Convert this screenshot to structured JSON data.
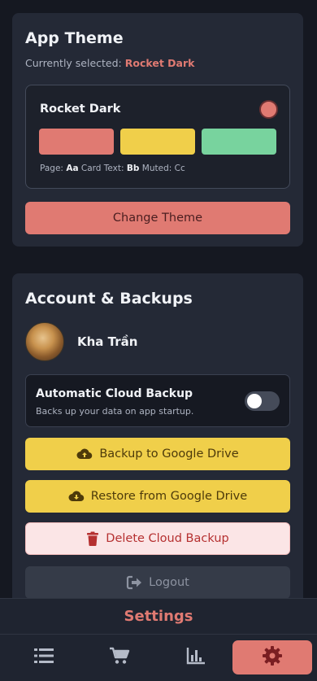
{
  "theme_card": {
    "title": "App Theme",
    "subtitle_prefix": "Currently selected:",
    "selected_theme": "Rocket Dark",
    "option": {
      "name": "Rocket Dark",
      "swatches": [
        "#e07a72",
        "#f0cf4a",
        "#78d39e"
      ],
      "dot_color": "#e07a72",
      "legend": {
        "page_label": "Page:",
        "page_sample": "Aa",
        "card_label": "Card Text:",
        "card_sample": "Bb",
        "muted_label": "Muted:",
        "muted_sample": "Cc"
      }
    },
    "change_button": "Change Theme"
  },
  "account_card": {
    "title": "Account & Backups",
    "user_name": "Kha Trần",
    "auto_backup": {
      "title": "Automatic Cloud Backup",
      "description": "Backs up your data on app startup.",
      "enabled": false
    },
    "buttons": {
      "backup": "Backup to Google Drive",
      "restore": "Restore from Google Drive",
      "delete": "Delete Cloud Backup",
      "logout": "Logout"
    }
  },
  "header": {
    "title": "Settings"
  },
  "tabs": [
    {
      "icon": "list-icon",
      "active": false
    },
    {
      "icon": "cart-icon",
      "active": false
    },
    {
      "icon": "chart-icon",
      "active": false
    },
    {
      "icon": "gear-icon",
      "active": true
    }
  ],
  "colors": {
    "accent": "#e07a72",
    "yellow": "#f0cf4a",
    "green": "#78d39e",
    "background": "#151821",
    "card": "#242936"
  }
}
